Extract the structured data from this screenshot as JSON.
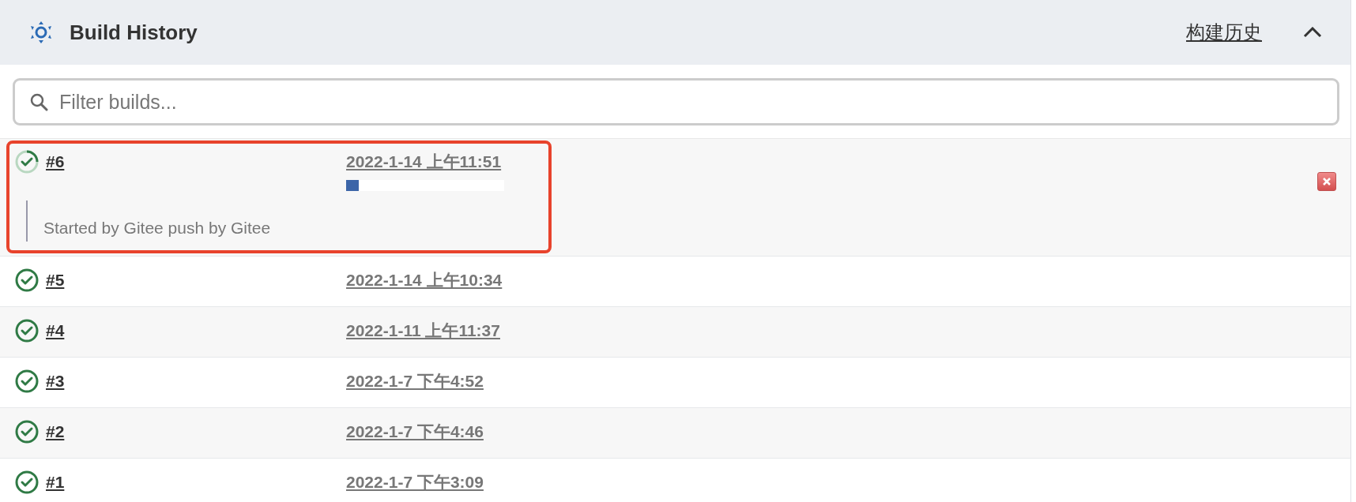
{
  "header": {
    "title": "Build History",
    "link": "构建历史",
    "expanded": true
  },
  "search": {
    "placeholder": "Filter builds..."
  },
  "builds": [
    {
      "number": "#6",
      "date": "2022-1-14 上午11:51",
      "kind": "running",
      "level": 0.08,
      "description": "Started by Gitee push by Gitee",
      "highlighted": true,
      "cancelable": true
    },
    {
      "number": "#5",
      "date": "2022-1-14 上午10:34",
      "kind": "success",
      "highlighted": false,
      "cancelable": false
    },
    {
      "number": "#4",
      "date": "2022-1-11 上午11:37",
      "kind": "success",
      "highlighted": false,
      "cancelable": false
    },
    {
      "number": "#3",
      "date": "2022-1-7 下午4:52",
      "kind": "success",
      "highlighted": false,
      "cancelable": false
    },
    {
      "number": "#2",
      "date": "2022-1-7 下午4:46",
      "kind": "success",
      "highlighted": false,
      "cancelable": false
    },
    {
      "number": "#1",
      "date": "2022-1-7 下午3:09",
      "kind": "success",
      "highlighted": false,
      "cancelable": false
    }
  ]
}
